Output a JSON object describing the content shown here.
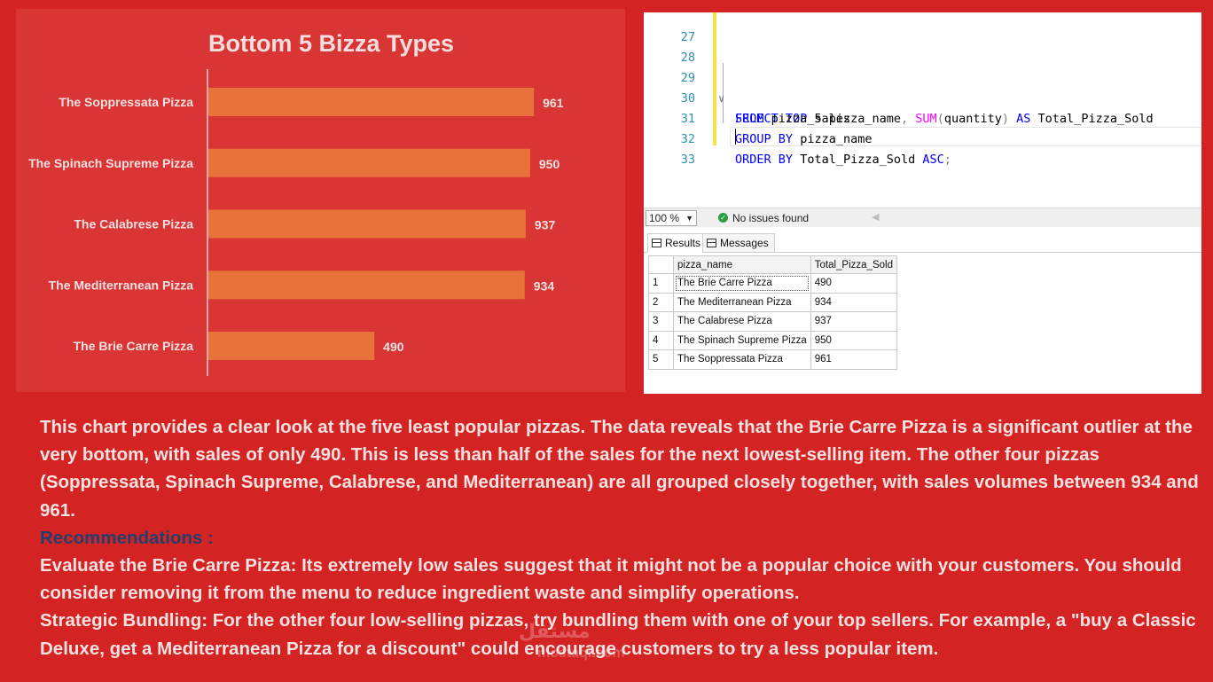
{
  "chart_data": {
    "type": "bar",
    "orientation": "horizontal",
    "title": "Bottom 5 Bizza Types",
    "categories": [
      "The Soppressata Pizza",
      "The Spinach Supreme Pizza",
      "The Calabrese Pizza",
      "The Mediterranean Pizza",
      "The Brie Carre Pizza"
    ],
    "values": [
      961,
      950,
      937,
      934,
      490
    ],
    "xlim": [
      0,
      1000
    ],
    "grid": false,
    "legend": "none",
    "bar_color": "#e8733a",
    "background_color": "#d93535"
  },
  "editor": {
    "lines": [
      {
        "num": "27",
        "code": ""
      },
      {
        "num": "28",
        "code": ""
      },
      {
        "num": "29",
        "code": "SELECT TOP 5 pizza_name, SUM(quantity) AS Total_Pizza_Sold"
      },
      {
        "num": "30",
        "code": "FROM pizza_sales"
      },
      {
        "num": "31",
        "code": "GROUP BY pizza_name"
      },
      {
        "num": "32",
        "code": "ORDER BY Total_Pizza_Sold ASC;"
      },
      {
        "num": "33",
        "code": ""
      }
    ],
    "fold_icon": "collapse-icon"
  },
  "statusbar": {
    "zoom": "100 %",
    "status": "No issues found",
    "status_icon": "check-circle-icon"
  },
  "tabs": {
    "results": "Results",
    "messages": "Messages",
    "results_icon": "grid-icon",
    "messages_icon": "message-icon"
  },
  "results": {
    "columns": [
      "pizza_name",
      "Total_Pizza_Sold"
    ],
    "rows": [
      {
        "n": "1",
        "name": "The Brie Carre Pizza",
        "sold": "490"
      },
      {
        "n": "2",
        "name": "The Mediterranean Pizza",
        "sold": "934"
      },
      {
        "n": "3",
        "name": "The Calabrese Pizza",
        "sold": "937"
      },
      {
        "n": "4",
        "name": "The Spinach Supreme Pizza",
        "sold": "950"
      },
      {
        "n": "5",
        "name": "The Soppressata Pizza",
        "sold": "961"
      }
    ]
  },
  "text": {
    "summary": "This chart provides a clear look at the five least popular pizzas. The data reveals that the Brie Carre Pizza is a significant outlier at the very bottom, with sales of only 490. This is less than half of the sales for the next lowest-selling item. The other four pizzas (Soppressata, Spinach Supreme, Calabrese, and Mediterranean) are all grouped closely together, with sales volumes between 934 and 961.",
    "rec_heading": "Recommendations :",
    "rec1": "Evaluate the Brie Carre Pizza: Its extremely low sales suggest that it might not be a popular choice with your customers. You should consider removing it from the menu to reduce ingredient waste and simplify operations.",
    "rec2": "Strategic Bundling: For the other four low-selling pizzas, try bundling them with one of your top sellers. For example, a \"buy a Classic Deluxe, get a Mediterranean Pizza for a discount\" could encourage customers to try a less popular item."
  },
  "watermark": {
    "main": "مستقل",
    "sub": "mostaql.com"
  },
  "colors": {
    "page_background": "#d42323",
    "heading_blue": "#1f3f6e",
    "keyword_blue": "#0000ff",
    "function_pink": "#ff00ff",
    "line_number": "#2b91af"
  }
}
